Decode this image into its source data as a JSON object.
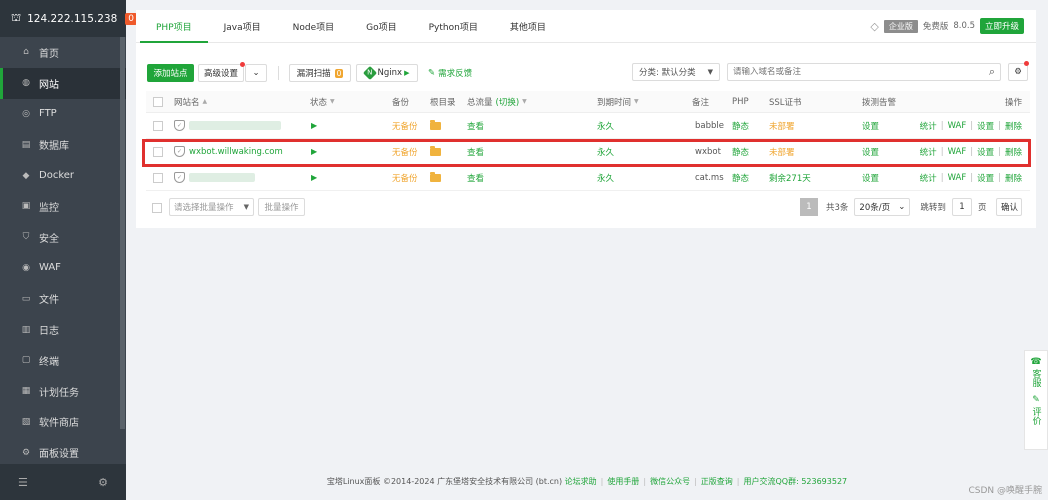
{
  "sidebar": {
    "server_ip": "124.222.115.238",
    "badge": "0",
    "items": [
      {
        "label": "首页",
        "icon": "home-icon",
        "glyph": "⌂"
      },
      {
        "label": "网站",
        "icon": "globe-icon",
        "glyph": "◍",
        "active": true
      },
      {
        "label": "FTP",
        "icon": "ftp-icon",
        "glyph": "◎"
      },
      {
        "label": "数据库",
        "icon": "database-icon",
        "glyph": "▤"
      },
      {
        "label": "Docker",
        "icon": "docker-icon",
        "glyph": "◆"
      },
      {
        "label": "监控",
        "icon": "monitor-icon",
        "glyph": "▣"
      },
      {
        "label": "安全",
        "icon": "shield-icon",
        "glyph": "⛉"
      },
      {
        "label": "WAF",
        "icon": "waf-icon",
        "glyph": "◉"
      },
      {
        "label": "文件",
        "icon": "folder-icon",
        "glyph": "▭"
      },
      {
        "label": "日志",
        "icon": "log-icon",
        "glyph": "▥"
      },
      {
        "label": "终端",
        "icon": "terminal-icon",
        "glyph": "▢"
      },
      {
        "label": "计划任务",
        "icon": "calendar-icon",
        "glyph": "▦"
      },
      {
        "label": "软件商店",
        "icon": "store-icon",
        "glyph": "▧"
      },
      {
        "label": "面板设置",
        "icon": "settings-icon",
        "glyph": "⚙"
      }
    ]
  },
  "tabs": [
    "PHP项目",
    "Java项目",
    "Node项目",
    "Go项目",
    "Python项目",
    "其他项目"
  ],
  "header_right": {
    "edition_badge": "企业版",
    "free_label": "免费版",
    "version": "8.0.5",
    "upgrade": "立即升级"
  },
  "toolbar": {
    "add_site": "添加站点",
    "advanced": "高级设置",
    "vuln_scan": "漏洞扫描",
    "vuln_count": "0",
    "nginx": "Nginx",
    "feedback": "需求反馈",
    "category": "分类: 默认分类",
    "search_placeholder": "请输入域名或备注"
  },
  "table": {
    "headers": {
      "name": "网站名",
      "status": "状态",
      "backup": "备份",
      "root": "根目录",
      "traffic": "总流量",
      "traffic_switch": "(切换)",
      "expire": "到期时间",
      "remark": "备注",
      "php": "PHP",
      "ssl": "SSL证书",
      "alert": "拨测告警",
      "ops": "操作"
    },
    "rows": [
      {
        "name": "",
        "backup": "无备份",
        "traffic": "查看",
        "expire": "永久",
        "remark": "babble",
        "php": "静态",
        "ssl": "未部署",
        "alert": "设置"
      },
      {
        "name": "wxbot.willwaking.com",
        "backup": "无备份",
        "traffic": "查看",
        "expire": "永久",
        "remark": "wxbot",
        "php": "静态",
        "ssl": "未部署",
        "alert": "设置"
      },
      {
        "name": "",
        "backup": "无备份",
        "traffic": "查看",
        "expire": "永久",
        "remark": "cat.ms",
        "php": "静态",
        "ssl": "剩余271天",
        "alert": "设置"
      }
    ],
    "ops": [
      "统计",
      "WAF",
      "设置",
      "删除"
    ]
  },
  "batch": {
    "select_placeholder": "请选择批量操作",
    "button": "批量操作"
  },
  "pager": {
    "current": "1",
    "total": "共3条",
    "per_page": "20条/页",
    "goto_label": "跳转到",
    "goto_value": "1",
    "page_unit": "页",
    "confirm": "确认"
  },
  "footer": {
    "copyright": "宝塔Linux面板 ©2014-2024 广东堡塔安全技术有限公司 (bt.cn)",
    "links": [
      "论坛求助",
      "使用手册",
      "微信公众号",
      "正版查询",
      "用户交流QQ群: 523693527"
    ]
  },
  "float_panel": {
    "service": "客服",
    "review": "评价"
  },
  "watermark": "CSDN @唤醒手腕",
  "colors": {
    "accent": "#20a53a",
    "warning": "#f0a630",
    "highlight": "#e0302e",
    "sidebar": "#3c444d"
  }
}
